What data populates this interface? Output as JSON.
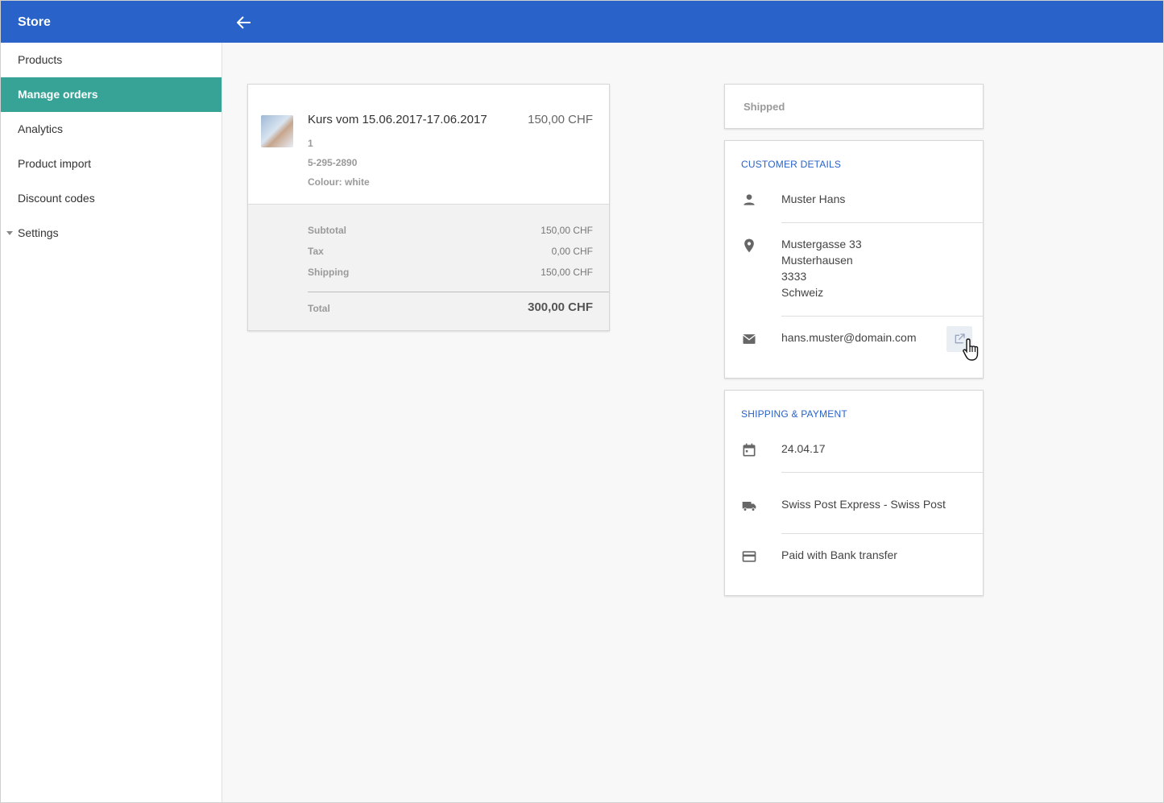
{
  "app": {
    "title": "Store"
  },
  "header": {
    "back_icon": "arrow-left-icon"
  },
  "sidebar": {
    "items": [
      {
        "label": "Products"
      },
      {
        "label": "Manage orders",
        "active": true
      },
      {
        "label": "Analytics"
      },
      {
        "label": "Product import"
      },
      {
        "label": "Discount codes"
      },
      {
        "label": "Settings",
        "expandable": true
      }
    ],
    "active_color": "#36a396"
  },
  "order": {
    "item": {
      "title": "Kurs vom 15.06.2017-17.06.2017",
      "price": "150,00 CHF",
      "quantity": "1",
      "sku": "5-295-2890",
      "variant": "Colour: white"
    },
    "summary": {
      "subtotal_label": "Subtotal",
      "subtotal_value": "150,00 CHF",
      "tax_label": "Tax",
      "tax_value": "0,00 CHF",
      "shipping_label": "Shipping",
      "shipping_value": "150,00 CHF",
      "total_label": "Total",
      "total_value": "300,00 CHF"
    }
  },
  "status": {
    "value": "Shipped"
  },
  "customer": {
    "title": "CUSTOMER DETAILS",
    "name": "Muster Hans",
    "address": [
      "Mustergasse 33",
      "Musterhausen",
      "3333",
      "Schweiz"
    ],
    "email": "hans.muster@domain.com"
  },
  "shipping_payment": {
    "title": "SHIPPING & PAYMENT",
    "date": "24.04.17",
    "method": "Swiss Post Express - Swiss Post",
    "payment": "Paid with Bank transfer"
  },
  "colors": {
    "primary": "#2962c8",
    "accent": "#36a396"
  }
}
